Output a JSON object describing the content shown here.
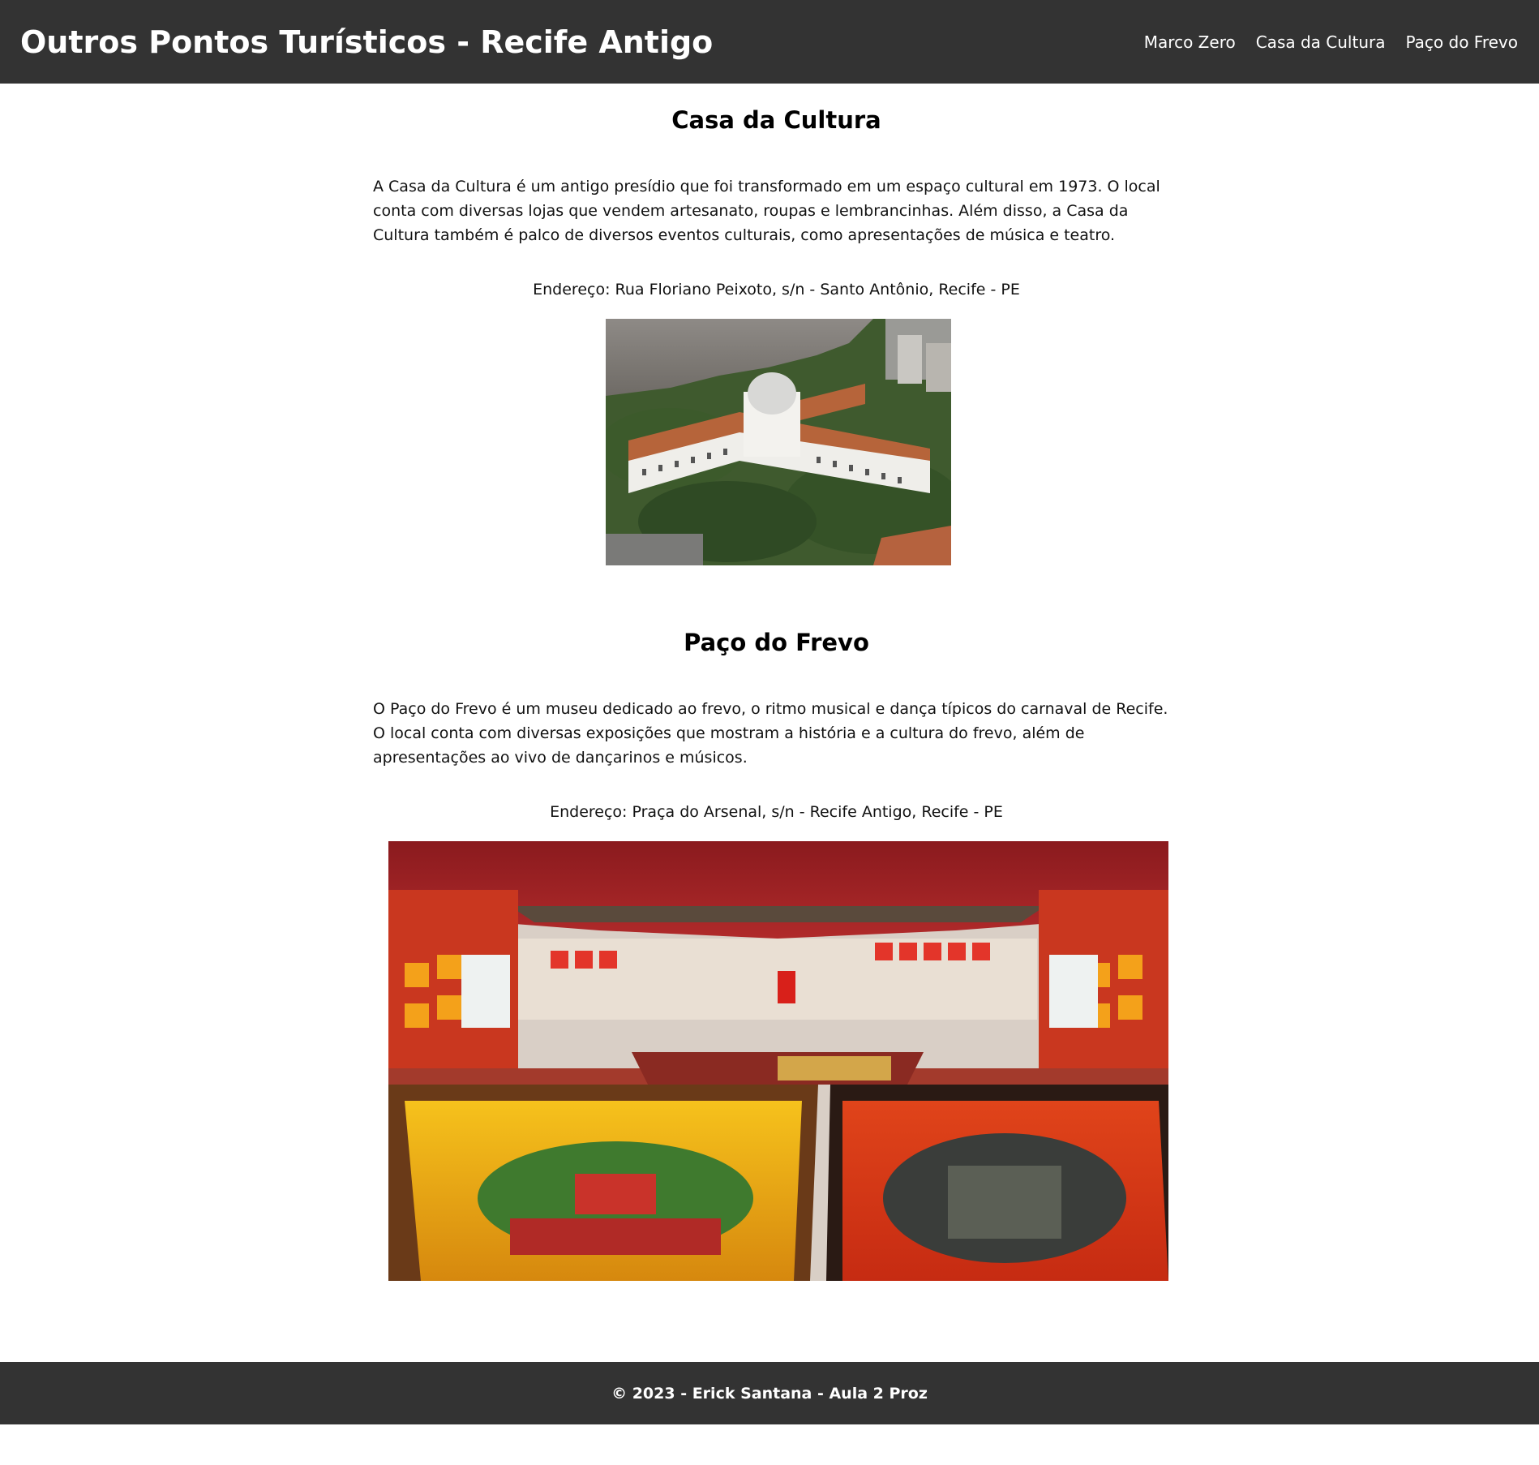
{
  "header": {
    "title": "Outros Pontos Turísticos - Recife Antigo",
    "nav": [
      {
        "label": "Marco Zero"
      },
      {
        "label": "Casa da Cultura"
      },
      {
        "label": "Paço do Frevo"
      }
    ]
  },
  "sections": [
    {
      "title": "Casa da Cultura",
      "description": "A Casa da Cultura é um antigo presídio que foi transformado em um espaço cultural em 1973. O local conta com diversas lojas que vendem artesanato, roupas e lembrancinhas. Além disso, a Casa da Cultura também é palco de diversos eventos culturais, como apresentações de música e teatro.",
      "address": "Endereço: Rua Floriano Peixoto, s/n - Santo Antônio, Recife - PE"
    },
    {
      "title": "Paço do Frevo",
      "description": "O Paço do Frevo é um museu dedicado ao frevo, o ritmo musical e dança típicos do carnaval de Recife. O local conta com diversas exposições que mostram a história e a cultura do frevo, além de apresentações ao vivo de dançarinos e músicos.",
      "address": "Endereço: Praça do Arsenal, s/n - Recife Antigo, Recife - PE"
    }
  ],
  "footer": {
    "text": "© 2023 - Erick Santana - Aula 2 Proz"
  },
  "colors": {
    "header_bg": "#333333",
    "footer_bg": "#333333",
    "header_text": "#ffffff"
  }
}
